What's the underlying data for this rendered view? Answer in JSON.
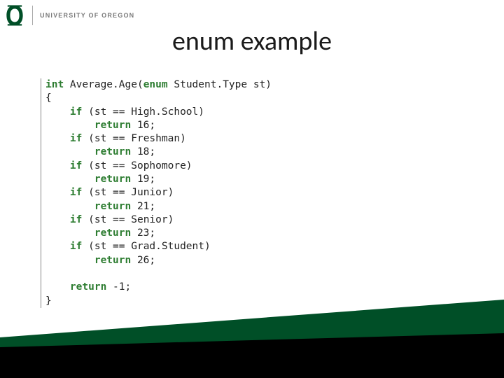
{
  "header": {
    "university": "UNIVERSITY OF OREGON"
  },
  "title": "enum example",
  "code": {
    "signature_prefix": "int",
    "signature_mid": " Average.Age(",
    "signature_kw2": "enum",
    "signature_tail": " Student.Type st)",
    "open_brace": "{",
    "lines": [
      {
        "if_open": "    if",
        "cond": " (st == High.School)"
      },
      {
        "ret": "        return",
        "val": " 16;"
      },
      {
        "if_open": "    if",
        "cond": " (st == Freshman)"
      },
      {
        "ret": "        return",
        "val": " 18;"
      },
      {
        "if_open": "    if",
        "cond": " (st == Sophomore)"
      },
      {
        "ret": "        return",
        "val": " 19;"
      },
      {
        "if_open": "    if",
        "cond": " (st == Junior)"
      },
      {
        "ret": "        return",
        "val": " 21;"
      },
      {
        "if_open": "    if",
        "cond": " (st == Senior)"
      },
      {
        "ret": "        return",
        "val": " 23;"
      },
      {
        "if_open": "    if",
        "cond": " (st == Grad.Student)"
      },
      {
        "ret": "        return",
        "val": " 26;"
      }
    ],
    "blank": "",
    "final_ret": "    return",
    "final_val": " -1;",
    "close_brace": "}"
  },
  "colors": {
    "brand_green": "#004F27",
    "keyword_green": "#2e7d32"
  }
}
